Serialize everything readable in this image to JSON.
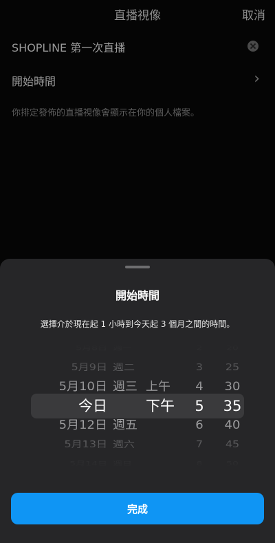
{
  "header": {
    "title": "直播視像",
    "cancel_label": "取消"
  },
  "form": {
    "title_value": "SHOPLINE 第一次直播",
    "start_time_label": "開始時間",
    "note": "你排定發佈的直播視像會顯示在你的個人檔案。"
  },
  "sheet": {
    "title": "開始時間",
    "description": "選擇介於現在起 1 小時到今天起 3 個月之間的時間。",
    "done_label": "完成"
  },
  "picker": {
    "columns": [
      {
        "name": "date",
        "selected_index": 3,
        "items": [
          "5月8日",
          "5月9日",
          "5月10日",
          "今日",
          "5月12日",
          "5月13日",
          "5月14日"
        ]
      },
      {
        "name": "weekday",
        "selected_index": 3,
        "items": [
          "週一",
          "週二",
          "週三",
          "",
          "週五",
          "週六",
          "週日"
        ]
      },
      {
        "name": "ampm",
        "selected_index": 1,
        "items": [
          "上午",
          "下午"
        ]
      },
      {
        "name": "hour",
        "selected_index": 3,
        "items": [
          "2",
          "3",
          "4",
          "5",
          "6",
          "7",
          "8"
        ]
      },
      {
        "name": "minute",
        "selected_index": 3,
        "items": [
          "20",
          "25",
          "30",
          "35",
          "40",
          "45",
          "50"
        ]
      }
    ]
  },
  "colors": {
    "sheet_background": "#262628",
    "selection_band": "#3a3a3c",
    "done_button": "#0f95f4",
    "page_background": "#050505"
  }
}
